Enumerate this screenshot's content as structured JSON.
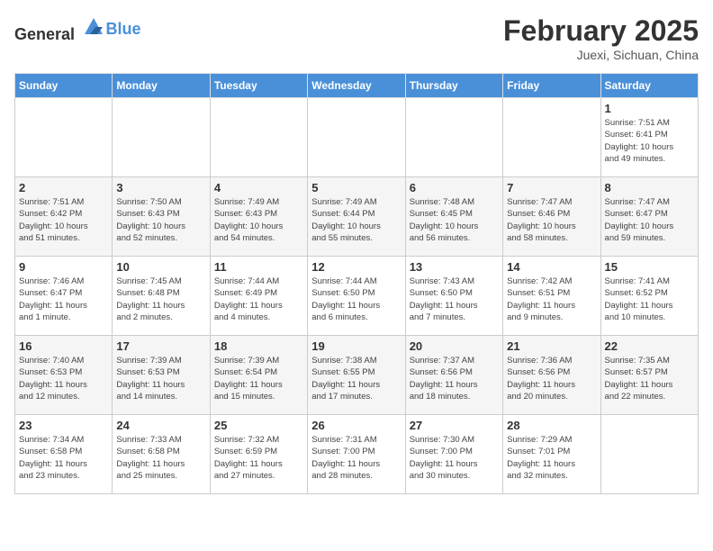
{
  "header": {
    "logo_general": "General",
    "logo_blue": "Blue",
    "month_title": "February 2025",
    "location": "Juexi, Sichuan, China"
  },
  "weekdays": [
    "Sunday",
    "Monday",
    "Tuesday",
    "Wednesday",
    "Thursday",
    "Friday",
    "Saturday"
  ],
  "weeks": [
    [
      {
        "day": "",
        "info": ""
      },
      {
        "day": "",
        "info": ""
      },
      {
        "day": "",
        "info": ""
      },
      {
        "day": "",
        "info": ""
      },
      {
        "day": "",
        "info": ""
      },
      {
        "day": "",
        "info": ""
      },
      {
        "day": "1",
        "info": "Sunrise: 7:51 AM\nSunset: 6:41 PM\nDaylight: 10 hours\nand 49 minutes."
      }
    ],
    [
      {
        "day": "2",
        "info": "Sunrise: 7:51 AM\nSunset: 6:42 PM\nDaylight: 10 hours\nand 51 minutes."
      },
      {
        "day": "3",
        "info": "Sunrise: 7:50 AM\nSunset: 6:43 PM\nDaylight: 10 hours\nand 52 minutes."
      },
      {
        "day": "4",
        "info": "Sunrise: 7:49 AM\nSunset: 6:43 PM\nDaylight: 10 hours\nand 54 minutes."
      },
      {
        "day": "5",
        "info": "Sunrise: 7:49 AM\nSunset: 6:44 PM\nDaylight: 10 hours\nand 55 minutes."
      },
      {
        "day": "6",
        "info": "Sunrise: 7:48 AM\nSunset: 6:45 PM\nDaylight: 10 hours\nand 56 minutes."
      },
      {
        "day": "7",
        "info": "Sunrise: 7:47 AM\nSunset: 6:46 PM\nDaylight: 10 hours\nand 58 minutes."
      },
      {
        "day": "8",
        "info": "Sunrise: 7:47 AM\nSunset: 6:47 PM\nDaylight: 10 hours\nand 59 minutes."
      }
    ],
    [
      {
        "day": "9",
        "info": "Sunrise: 7:46 AM\nSunset: 6:47 PM\nDaylight: 11 hours\nand 1 minute."
      },
      {
        "day": "10",
        "info": "Sunrise: 7:45 AM\nSunset: 6:48 PM\nDaylight: 11 hours\nand 2 minutes."
      },
      {
        "day": "11",
        "info": "Sunrise: 7:44 AM\nSunset: 6:49 PM\nDaylight: 11 hours\nand 4 minutes."
      },
      {
        "day": "12",
        "info": "Sunrise: 7:44 AM\nSunset: 6:50 PM\nDaylight: 11 hours\nand 6 minutes."
      },
      {
        "day": "13",
        "info": "Sunrise: 7:43 AM\nSunset: 6:50 PM\nDaylight: 11 hours\nand 7 minutes."
      },
      {
        "day": "14",
        "info": "Sunrise: 7:42 AM\nSunset: 6:51 PM\nDaylight: 11 hours\nand 9 minutes."
      },
      {
        "day": "15",
        "info": "Sunrise: 7:41 AM\nSunset: 6:52 PM\nDaylight: 11 hours\nand 10 minutes."
      }
    ],
    [
      {
        "day": "16",
        "info": "Sunrise: 7:40 AM\nSunset: 6:53 PM\nDaylight: 11 hours\nand 12 minutes."
      },
      {
        "day": "17",
        "info": "Sunrise: 7:39 AM\nSunset: 6:53 PM\nDaylight: 11 hours\nand 14 minutes."
      },
      {
        "day": "18",
        "info": "Sunrise: 7:39 AM\nSunset: 6:54 PM\nDaylight: 11 hours\nand 15 minutes."
      },
      {
        "day": "19",
        "info": "Sunrise: 7:38 AM\nSunset: 6:55 PM\nDaylight: 11 hours\nand 17 minutes."
      },
      {
        "day": "20",
        "info": "Sunrise: 7:37 AM\nSunset: 6:56 PM\nDaylight: 11 hours\nand 18 minutes."
      },
      {
        "day": "21",
        "info": "Sunrise: 7:36 AM\nSunset: 6:56 PM\nDaylight: 11 hours\nand 20 minutes."
      },
      {
        "day": "22",
        "info": "Sunrise: 7:35 AM\nSunset: 6:57 PM\nDaylight: 11 hours\nand 22 minutes."
      }
    ],
    [
      {
        "day": "23",
        "info": "Sunrise: 7:34 AM\nSunset: 6:58 PM\nDaylight: 11 hours\nand 23 minutes."
      },
      {
        "day": "24",
        "info": "Sunrise: 7:33 AM\nSunset: 6:58 PM\nDaylight: 11 hours\nand 25 minutes."
      },
      {
        "day": "25",
        "info": "Sunrise: 7:32 AM\nSunset: 6:59 PM\nDaylight: 11 hours\nand 27 minutes."
      },
      {
        "day": "26",
        "info": "Sunrise: 7:31 AM\nSunset: 7:00 PM\nDaylight: 11 hours\nand 28 minutes."
      },
      {
        "day": "27",
        "info": "Sunrise: 7:30 AM\nSunset: 7:00 PM\nDaylight: 11 hours\nand 30 minutes."
      },
      {
        "day": "28",
        "info": "Sunrise: 7:29 AM\nSunset: 7:01 PM\nDaylight: 11 hours\nand 32 minutes."
      },
      {
        "day": "",
        "info": ""
      }
    ]
  ]
}
